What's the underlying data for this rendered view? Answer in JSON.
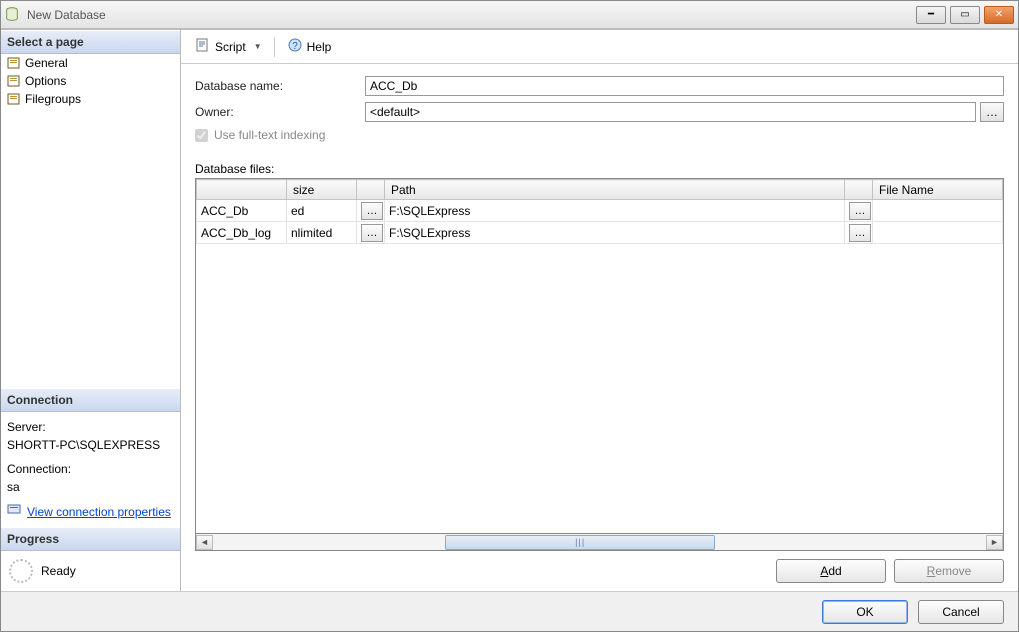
{
  "window": {
    "title": "New Database"
  },
  "sidebar": {
    "select_page": "Select a page",
    "items": [
      {
        "label": "General"
      },
      {
        "label": "Options"
      },
      {
        "label": "Filegroups"
      }
    ],
    "connection_head": "Connection",
    "server_label": "Server:",
    "server_value": "SHORTT-PC\\SQLEXPRESS",
    "conn_label": "Connection:",
    "conn_value": "sa",
    "view_conn": "View connection properties",
    "progress_head": "Progress",
    "progress_status": "Ready"
  },
  "toolbar": {
    "script": "Script",
    "help": "Help"
  },
  "form": {
    "dbname_label": "Database name:",
    "dbname_value": "ACC_Db",
    "owner_label": "Owner:",
    "owner_value": "<default>",
    "fulltext": "Use full-text indexing",
    "files_label": "Database files:",
    "col_size": "size",
    "col_path": "Path",
    "col_filename": "File Name",
    "rows": [
      {
        "name": "ACC_Db",
        "size": "ed",
        "path": "F:\\SQLExpress"
      },
      {
        "name": "ACC_Db_log",
        "size": "nlimited",
        "path": "F:\\SQLExpress"
      }
    ]
  },
  "buttons": {
    "add": "Add",
    "remove": "Remove",
    "ok": "OK",
    "cancel": "Cancel"
  }
}
